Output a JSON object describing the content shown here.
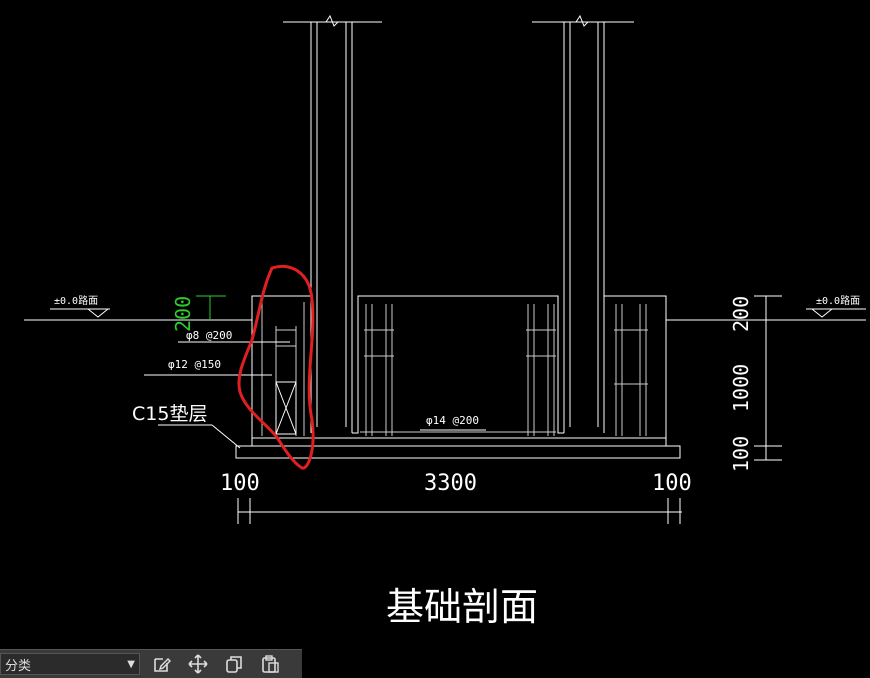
{
  "drawing": {
    "title": "基础剖面",
    "labels": {
      "ground_left": "±0.0路面",
      "ground_right": "±0.0路面",
      "rebar_top": "φ8 @200",
      "rebar_mid": "φ12 @150",
      "bottom_bar": "φ14 @200",
      "cushion": "C15垫层",
      "green_dim": "200"
    },
    "dims_bottom": [
      "100",
      "3300",
      "100"
    ],
    "dims_right": [
      "200",
      "1000",
      "100"
    ]
  },
  "toolbar": {
    "dropdown_label": "分类",
    "icons": [
      "edit-icon",
      "move-icon",
      "copy-icon",
      "paste-icon"
    ]
  }
}
